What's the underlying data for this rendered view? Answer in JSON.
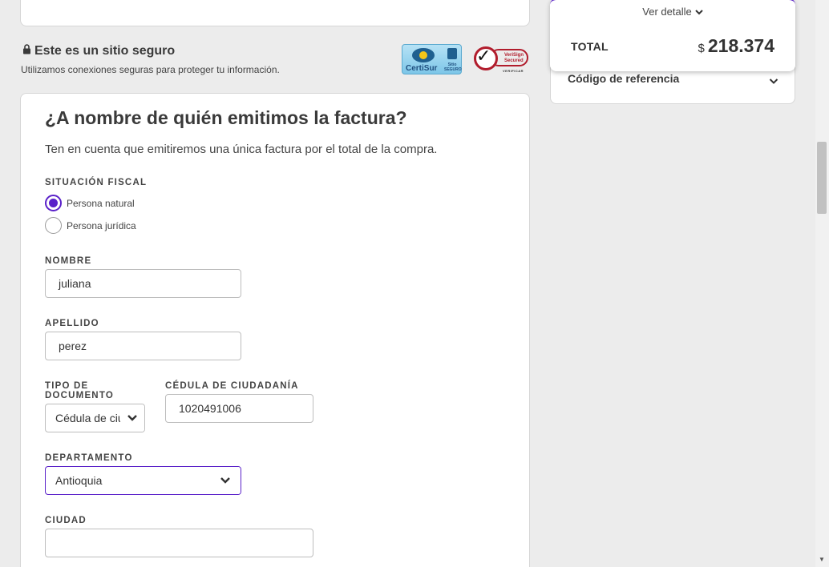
{
  "secure": {
    "title": "Este es un sitio seguro",
    "subtitle": "Utilizamos conexiones seguras para proteger tu información.",
    "certisur_label": "CertiSur",
    "certisur_sub": "Sitio SEGURO",
    "verisign_label": "VeriSign Secured",
    "verisign_sub": "VERIFICAR"
  },
  "form": {
    "title": "¿A nombre de quién emitimos la factura?",
    "description": "Ten en cuenta que emitiremos una única factura por el total de la compra.",
    "fiscal_label": "SITUACIÓN FISCAL",
    "fiscal_options": [
      "Persona natural",
      "Persona jurídica"
    ],
    "fiscal_selected": "Persona natural",
    "nombre_label": "NOMBRE",
    "nombre_value": "juliana",
    "apellido_label": "APELLIDO",
    "apellido_value": "perez",
    "tipo_doc_label_1": "TIPO DE",
    "tipo_doc_label_2": "DOCUMENTO",
    "tipo_doc_value": "Cédula de ciudadanía",
    "cedula_label": "CÉDULA DE CIUDADANÍA",
    "cedula_value": "1020491006",
    "departamento_label": "DEPARTAMENTO",
    "departamento_value": "Antioquia",
    "ciudad_label": "CIUDAD",
    "ciudad_value": ""
  },
  "summary": {
    "ver_detalle": "Ver detalle",
    "total_label": "TOTAL",
    "currency": "$",
    "total_amount": "218.374",
    "referencia_label": "Código de referencia"
  },
  "colors": {
    "accent": "#5a21c9",
    "background": "#ececec"
  }
}
